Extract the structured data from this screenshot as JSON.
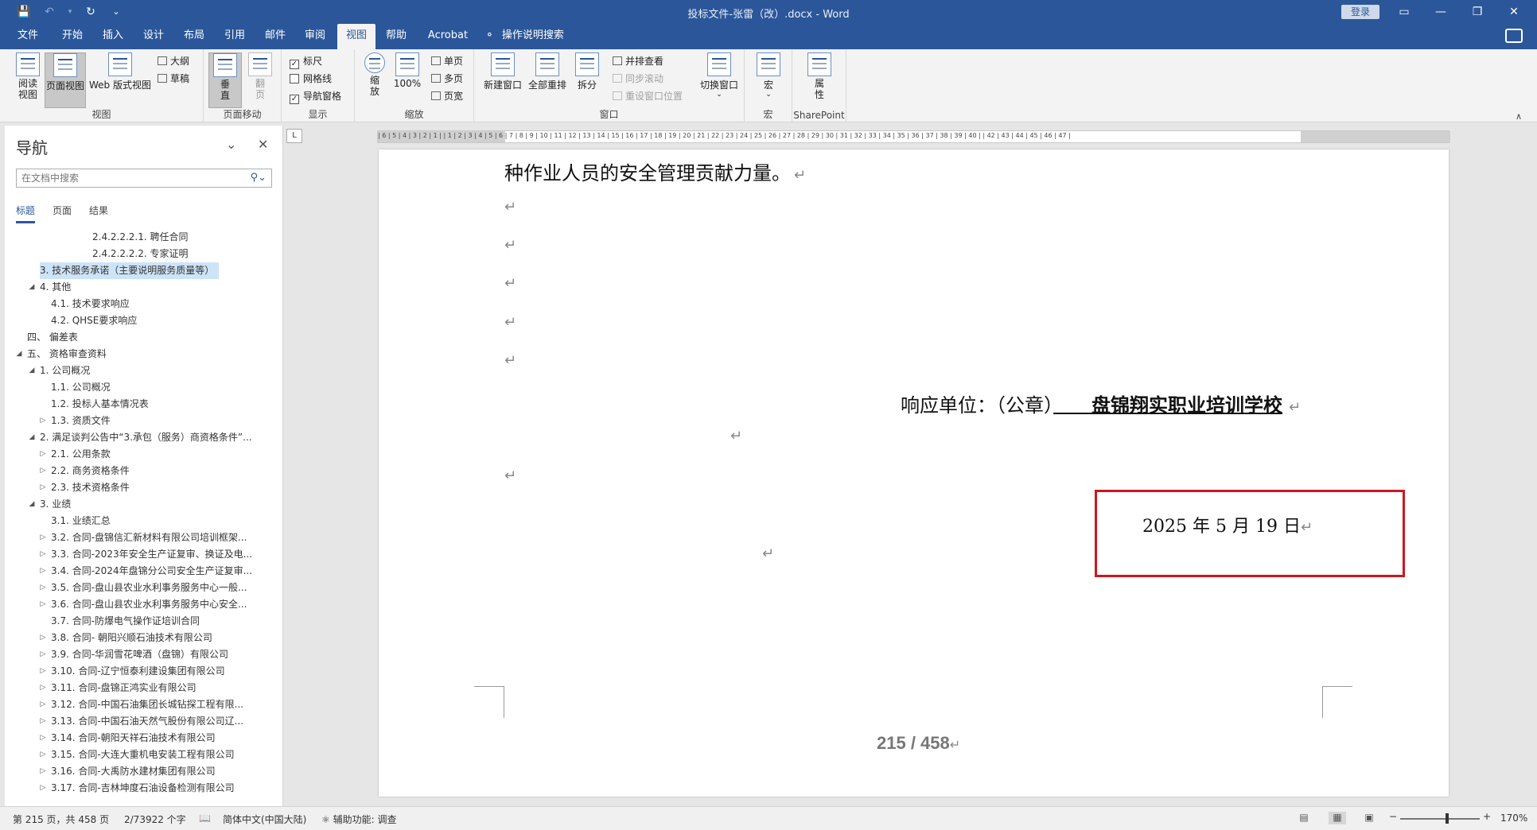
{
  "window": {
    "title": "投标文件-张雷（改）.docx - Word",
    "login_label": "登录",
    "qat": {
      "save_icon": "save-icon",
      "undo_icon": "undo-icon",
      "redo_icon": "redo-icon",
      "customize_icon": "customize-icon"
    },
    "controls": {
      "ribbon_display": "▭",
      "minimize": "—",
      "restore": "❐",
      "close": "✕"
    }
  },
  "tabs": [
    "文件",
    "开始",
    "插入",
    "设计",
    "布局",
    "引用",
    "邮件",
    "审阅",
    "视图",
    "帮助",
    "Acrobat"
  ],
  "active_tab": "视图",
  "tell_me": "操作说明搜索",
  "ribbon": {
    "views": {
      "read_mode": "阅读\n视图",
      "print_layout": "页面视图",
      "web_layout": "Web 版式视图",
      "outline": "大纲",
      "draft": "草稿",
      "group": "视图"
    },
    "page_movement": {
      "vertical": "垂\n直",
      "side_to_side": "翻\n页",
      "group": "页面移动"
    },
    "show": {
      "ruler": "标尺",
      "gridlines": "网格线",
      "nav_pane": "导航窗格",
      "group": "显示",
      "ruler_checked": true,
      "gridlines_checked": false,
      "nav_checked": true
    },
    "zoom": {
      "zoom": "缩\n放",
      "hundred": "100%",
      "one_page": "单页",
      "multi_page": "多页",
      "page_width": "页宽",
      "group": "缩放"
    },
    "window": {
      "new_window": "新建窗口",
      "arrange_all": "全部重排",
      "split": "拆分",
      "side_by_side": "并排查看",
      "sync_scroll": "同步滚动",
      "reset_pos": "重设窗口位置",
      "switch": "切换窗口",
      "group": "窗口"
    },
    "macros": {
      "macros": "宏",
      "group": "宏"
    },
    "sharepoint": {
      "properties": "属\n性",
      "group": "SharePoint"
    }
  },
  "nav": {
    "title": "导航",
    "search_placeholder": "在文档中搜索",
    "tabs": [
      "标题",
      "页面",
      "结果"
    ],
    "items": [
      {
        "label": "2.4.2.2.2.1. 聘任合同",
        "indent": 110,
        "toggle": ""
      },
      {
        "label": "2.4.2.2.2.2. 专家证明",
        "indent": 110,
        "toggle": ""
      },
      {
        "label": "3. 技术服务承诺（主要说明服务质量等）",
        "indent": 44,
        "toggle": "",
        "selected": true
      },
      {
        "label": "4. 其他",
        "indent": 44,
        "toggle": "◢"
      },
      {
        "label": "4.1. 技术要求响应",
        "indent": 58,
        "toggle": ""
      },
      {
        "label": "4.2. QHSE要求响应",
        "indent": 58,
        "toggle": ""
      },
      {
        "label": "四、 偏差表",
        "indent": 28,
        "toggle": ""
      },
      {
        "label": "五、 资格审查资料",
        "indent": 28,
        "toggle": "◢"
      },
      {
        "label": "1. 公司概况",
        "indent": 44,
        "toggle": "◢"
      },
      {
        "label": "1.1. 公司概况",
        "indent": 58,
        "toggle": ""
      },
      {
        "label": "1.2. 投标人基本情况表",
        "indent": 58,
        "toggle": ""
      },
      {
        "label": "1.3. 资质文件",
        "indent": 58,
        "toggle": "▷"
      },
      {
        "label": "2. 满足谈判公告中“3.承包（服务）商资格条件”...",
        "indent": 44,
        "toggle": "◢"
      },
      {
        "label": "2.1. 公用条款",
        "indent": 58,
        "toggle": "▷"
      },
      {
        "label": "2.2. 商务资格条件",
        "indent": 58,
        "toggle": "▷"
      },
      {
        "label": "2.3. 技术资格条件",
        "indent": 58,
        "toggle": "▷"
      },
      {
        "label": "3. 业绩",
        "indent": 44,
        "toggle": "◢"
      },
      {
        "label": "3.1. 业绩汇总",
        "indent": 58,
        "toggle": ""
      },
      {
        "label": "3.2. 合同-盘锦信汇新材料有限公司培训框架...",
        "indent": 58,
        "toggle": "▷"
      },
      {
        "label": "3.3. 合同-2023年安全生产证复审、换证及电...",
        "indent": 58,
        "toggle": "▷"
      },
      {
        "label": "3.4. 合同-2024年盘锦分公司安全生产证复审...",
        "indent": 58,
        "toggle": "▷"
      },
      {
        "label": "3.5. 合同-盘山县农业水利事务服务中心一般...",
        "indent": 58,
        "toggle": "▷"
      },
      {
        "label": "3.6. 合同-盘山县农业水利事务服务中心安全...",
        "indent": 58,
        "toggle": "▷"
      },
      {
        "label": "3.7. 合同-防爆电气操作证培训合同",
        "indent": 58,
        "toggle": ""
      },
      {
        "label": "3.8. 合同- 朝阳兴顺石油技术有限公司",
        "indent": 58,
        "toggle": "▷"
      },
      {
        "label": "3.9. 合同-华润雪花啤酒（盘锦）有限公司",
        "indent": 58,
        "toggle": "▷"
      },
      {
        "label": "3.10. 合同-辽宁恒泰利建设集团有限公司",
        "indent": 58,
        "toggle": "▷"
      },
      {
        "label": "3.11. 合同-盘锦正鸿实业有限公司",
        "indent": 58,
        "toggle": "▷"
      },
      {
        "label": "3.12. 合同-中国石油集团长城钻探工程有限...",
        "indent": 58,
        "toggle": "▷"
      },
      {
        "label": "3.13. 合同-中国石油天然气股份有限公司辽...",
        "indent": 58,
        "toggle": "▷"
      },
      {
        "label": "3.14. 合同-朝阳天祥石油技术有限公司",
        "indent": 58,
        "toggle": "▷"
      },
      {
        "label": "3.15. 合同-大连大重机电安装工程有限公司",
        "indent": 58,
        "toggle": "▷"
      },
      {
        "label": "3.16. 合同-大禹防水建材集团有限公司",
        "indent": 58,
        "toggle": "▷"
      },
      {
        "label": "3.17. 合同-吉林坤度石油设备检测有限公司",
        "indent": 58,
        "toggle": "▷"
      }
    ]
  },
  "ruler": {
    "tab_selector": "L",
    "numbers": "| 6 | 5 | 4 | 3 | 2 | 1 |     | 1 | 2 | 3 | 4 | 5 | 6 | 7 | 8 | 9 | 10 | 11 | 12 | 13 | 14 | 15 | 16 | 17 | 18 | 19 | 20 | 21 | 22 | 23 | 24 | 25 | 26 | 27 | 28 | 29 | 30 | 31 | 32 | 33 | 34 | 35 | 36 | 37 | 38 | 39 | 40 |     | 42 | 43 | 44 | 45 | 46 | 47 |"
  },
  "document": {
    "line1": "种作业人员的安全管理贡献力量。",
    "para_mark": "↵",
    "response_prefix": "响应单位：（公章）",
    "response_company": "　　盘锦翔实职业培训学校",
    "date": "2025  年  5  月  19 日",
    "page_number": "215 / 458"
  },
  "status": {
    "page": "第 215 页，共 458 页",
    "words": "2/73922 个字",
    "proof_icon": "proofing-icon",
    "language": "简体中文(中国大陆)",
    "accessibility": "辅助功能: 调查",
    "zoom_minus": "−",
    "zoom_plus": "+",
    "zoom": "170%",
    "zoom_level": 170
  }
}
